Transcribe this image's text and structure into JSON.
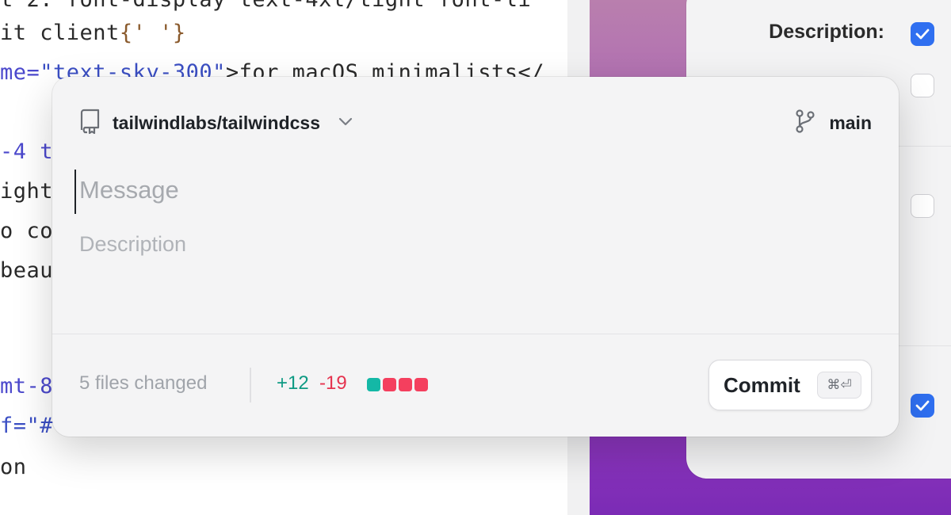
{
  "editor": {
    "lines": [
      {
        "parts": [
          {
            "t": "t 2: font-display text-4xl/tight font-li",
            "c": "plain"
          }
        ]
      },
      {
        "parts": [
          {
            "t": "it client",
            "c": "plain"
          },
          {
            "t": "{' '}",
            "c": "punc"
          }
        ]
      },
      {
        "parts": [
          {
            "t": "me=",
            "c": "attr"
          },
          {
            "t": "\"text-sky-300\"",
            "c": "str"
          },
          {
            "t": ">for macOS minimalists</",
            "c": "plain"
          }
        ]
      },
      {
        "parts": [
          {
            "t": "",
            "c": "plain"
          }
        ]
      },
      {
        "parts": [
          {
            "t": "-4 t",
            "c": "attr"
          }
        ]
      },
      {
        "parts": [
          {
            "t": "ightw",
            "c": "plain"
          }
        ]
      },
      {
        "parts": [
          {
            "t": "o co",
            "c": "plain"
          }
        ]
      },
      {
        "parts": [
          {
            "t": "beaut",
            "c": "plain"
          }
        ]
      },
      {
        "parts": [
          {
            "t": "",
            "c": "plain"
          }
        ]
      },
      {
        "parts": [
          {
            "t": "",
            "c": "plain"
          }
        ]
      },
      {
        "parts": [
          {
            "t": "mt-8",
            "c": "attr"
          }
        ]
      },
      {
        "parts": [
          {
            "t": "f=\"#\"",
            "c": "str"
          }
        ]
      },
      {
        "parts": [
          {
            "t": "on",
            "c": "plain"
          }
        ]
      }
    ]
  },
  "settings": {
    "description_label": "Description:",
    "checkboxes": [
      {
        "checked": true
      },
      {
        "checked": false
      },
      {
        "checked": false
      },
      {
        "checked": true
      }
    ]
  },
  "commit": {
    "repo_icon": "repo-book-icon",
    "repo_name": "tailwindlabs/tailwindcss",
    "repo_dropdown_icon": "chevron-down-icon",
    "branch_icon": "git-branch-icon",
    "branch_name": "main",
    "message_placeholder": "Message",
    "message_value": "",
    "description_placeholder": "Description",
    "description_value": "",
    "files_changed": "5 files changed",
    "additions": "+12",
    "deletions": "-19",
    "diffstat_blocks": [
      "#14b8a6",
      "#f43f5e",
      "#f43f5e",
      "#f43f5e"
    ],
    "commit_label": "Commit",
    "commit_shortcut": "⌘⏎"
  },
  "colors": {
    "additions": "#0e9a83",
    "deletions": "#e5334f",
    "checkbox_checked": "#2f6ff0"
  }
}
